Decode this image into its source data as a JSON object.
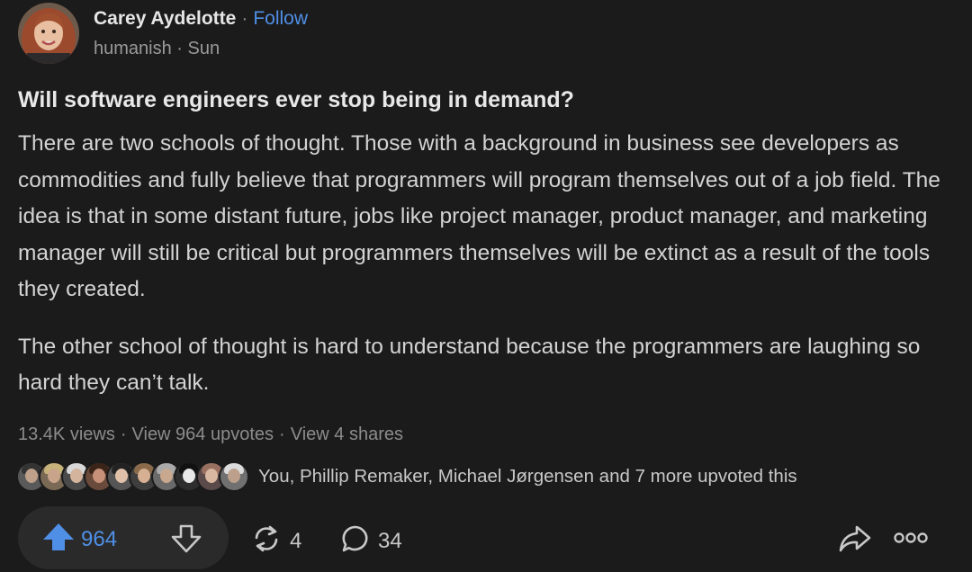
{
  "author": {
    "name": "Carey Aydelotte",
    "separator": "·",
    "follow_label": "Follow",
    "space": "humanish",
    "time": "Sun",
    "meta_separator": " · "
  },
  "post": {
    "question": "Will software engineers ever stop being in demand?",
    "paragraphs": [
      "There are two schools of thought. Those with a background in business see developers as commodities and fully believe that programmers will program themselves out of a job field. The idea is that in some distant future, jobs like project manager, product manager, and marketing manager will still be critical but programmers themselves will be extinct as a result of the tools they created.",
      "The other school of thought is hard to understand because the programmers are laughing so hard they can’t talk."
    ]
  },
  "stats": {
    "views": "13.4K views",
    "upvotes_link": "View 964 upvotes",
    "shares_link": "View 4 shares",
    "separator": "·"
  },
  "upvoters": {
    "text": "You, Phillip Remaker, Michael Jørgensen and 7 more upvoted this",
    "avatar_count": 10
  },
  "actions": {
    "upvote_count": "964",
    "share_count": "4",
    "comment_count": "34"
  },
  "icons": {
    "upvote": "upvote-arrow-icon",
    "downvote": "downvote-arrow-icon",
    "share": "reshare-icon",
    "comment": "comment-bubble-icon",
    "forward": "forward-share-icon",
    "more": "more-options-icon"
  },
  "colors": {
    "background": "#1b1b1b",
    "accent": "#4f8fe6",
    "pill": "#2a2a2a",
    "text": "#d3d3d3",
    "muted": "#8c8c8c"
  }
}
